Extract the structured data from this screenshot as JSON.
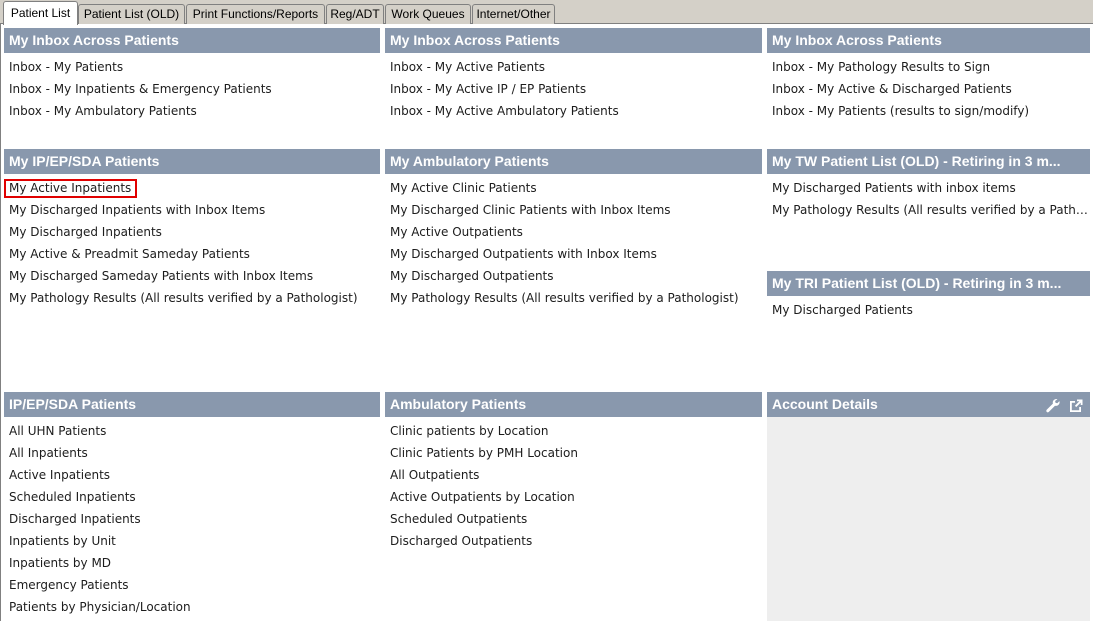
{
  "tabs": [
    {
      "label": "Patient List",
      "active": true
    },
    {
      "label": "Patient List (OLD)"
    },
    {
      "label": "Print Functions/Reports"
    },
    {
      "label": "Reg/ADT"
    },
    {
      "label": "Work Queues"
    },
    {
      "label": "Internet/Other"
    }
  ],
  "panels": {
    "inbox1": {
      "title": "My Inbox Across Patients",
      "items": [
        "Inbox - My Patients",
        "Inbox - My Inpatients &  Emergency Patients",
        "Inbox - My Ambulatory Patients"
      ]
    },
    "inbox2": {
      "title": "My Inbox Across Patients",
      "items": [
        "Inbox - My Active Patients",
        "Inbox - My Active IP / EP Patients",
        "Inbox - My Active Ambulatory Patients"
      ]
    },
    "inbox3": {
      "title": "My Inbox Across Patients",
      "items": [
        "Inbox - My Pathology Results to Sign",
        "Inbox - My Active & Discharged Patients",
        "Inbox - My Patients (results to sign/modify)"
      ]
    },
    "my_ip": {
      "title": "My IP/EP/SDA Patients",
      "items": [
        "My Active Inpatients",
        "My Discharged Inpatients with Inbox Items",
        "My Discharged Inpatients",
        "My Active & Preadmit Sameday Patients",
        "My Discharged Sameday Patients with Inbox Items",
        "My Pathology Results (All results verified by a Pathologist)"
      ]
    },
    "my_amb": {
      "title": "My Ambulatory Patients",
      "items": [
        "My Active Clinic Patients",
        "My Discharged Clinic Patients with Inbox Items",
        "My Active Outpatients",
        "My Discharged Outpatients with Inbox Items",
        "My Discharged Outpatients",
        "My Pathology Results (All results verified by a Pathologist)"
      ]
    },
    "my_tw": {
      "title": "My TW Patient List (OLD) - Retiring in 3 m...",
      "items": [
        "My Discharged Patients with inbox items",
        "My Pathology Results (All results verified by a Pathologi..."
      ]
    },
    "my_tri": {
      "title": "My TRI Patient List (OLD) - Retiring in 3 m...",
      "items": [
        "My Discharged Patients"
      ]
    },
    "ip": {
      "title": "IP/EP/SDA Patients",
      "items": [
        "All UHN Patients",
        "All Inpatients",
        "Active Inpatients",
        "Scheduled Inpatients",
        "Discharged Inpatients",
        "Inpatients by Unit",
        "Inpatients by MD",
        "Emergency Patients",
        "Patients by Physician/Location"
      ]
    },
    "amb": {
      "title": "Ambulatory Patients",
      "items": [
        "Clinic patients by Location",
        "Clinic Patients by PMH Location",
        "All Outpatients",
        "Active Outpatients by Location",
        "Scheduled Outpatients",
        "Discharged Outpatients"
      ]
    },
    "account": {
      "title": "Account Details",
      "icons": [
        "wrench-icon",
        "external-link-icon"
      ]
    }
  },
  "colors": {
    "header_bg": "#8998ad",
    "highlight_border": "#e00000"
  }
}
